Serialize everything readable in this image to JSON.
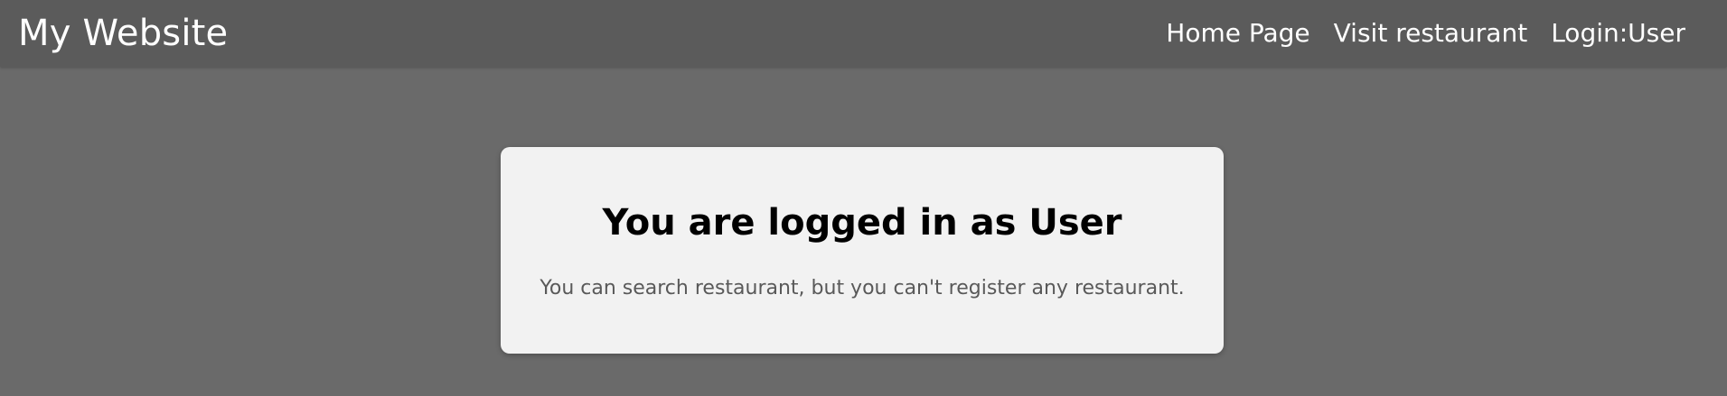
{
  "navbar": {
    "brand": "My Website",
    "links": [
      {
        "label": "Home Page"
      },
      {
        "label": "Visit restaurant"
      },
      {
        "label": "Login:User"
      }
    ]
  },
  "card": {
    "title": "You are logged in as User",
    "message": "You can search restaurant, but you can't register any restaurant."
  },
  "colors": {
    "page_background": "#6a6a6a",
    "navbar_background": "#5b5b5b",
    "card_background": "#f2f2f2",
    "title_text": "#000000",
    "message_text": "#595959",
    "nav_text": "#ffffff"
  }
}
